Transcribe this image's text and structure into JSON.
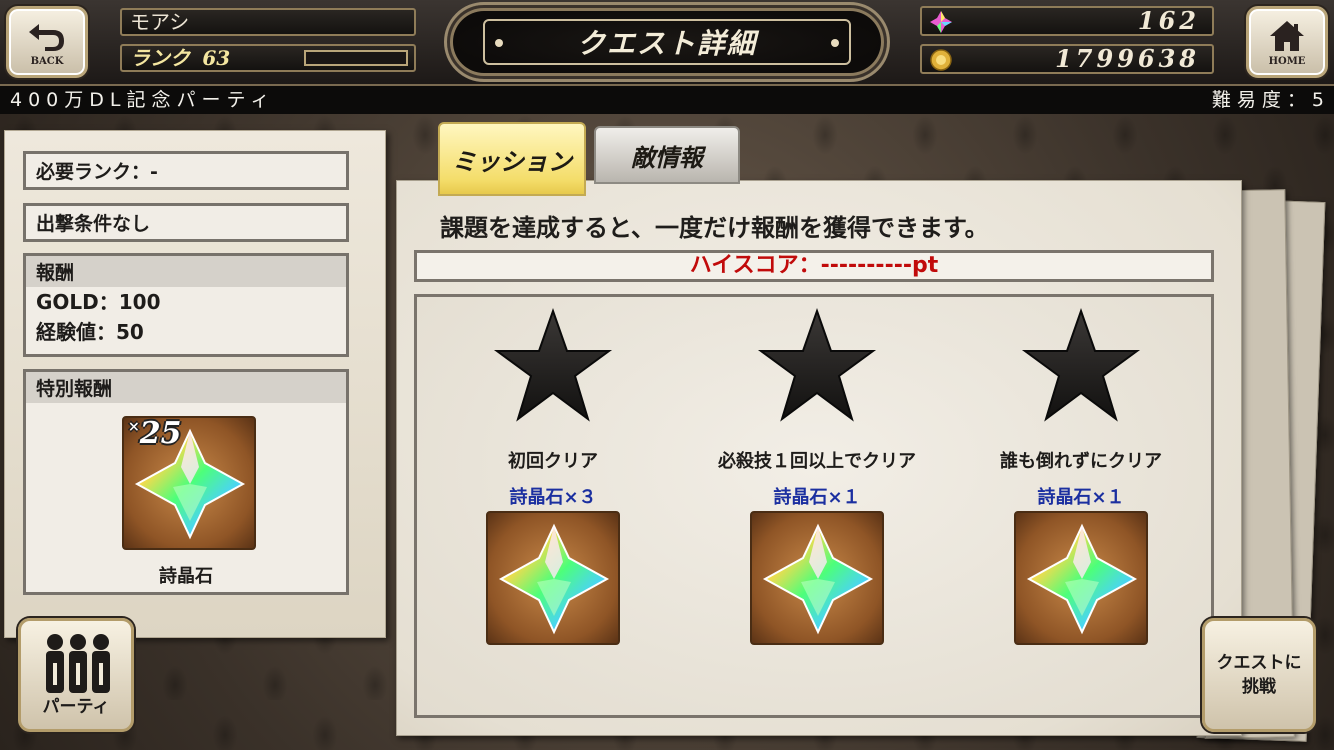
{
  "header": {
    "back_label": "BACK",
    "home_label": "HOME",
    "player_name": "モアシ",
    "rank_label": "ランク",
    "rank_value": "63",
    "rank_progress": 0.0,
    "title": "クエスト詳細",
    "gems": "162",
    "gold": "1799638"
  },
  "subbar": {
    "party_name": "400万DL記念パーティ",
    "difficulty": "難易度：5"
  },
  "left": {
    "required_rank": "必要ランク：-",
    "sortie_condition": "出撃条件なし",
    "reward_title": "報酬",
    "reward_gold": "GOLD：100",
    "reward_exp": "経験値：50",
    "special_title": "特別報酬",
    "special_qty_prefix": "×",
    "special_qty": "25",
    "special_item_name": "詩晶石",
    "party_button_label": "パーティ"
  },
  "tabs": {
    "mission": "ミッション",
    "enemy": "敵情報"
  },
  "main": {
    "description": "課題を達成すると、一度だけ報酬を獲得できます。",
    "high_score": "ハイスコア：----------pt",
    "missions": [
      {
        "label": "初回クリア",
        "reward": "詩晶石×３"
      },
      {
        "label": "必殺技１回以上でクリア",
        "reward": "詩晶石×１"
      },
      {
        "label": "誰も倒れずにクリア",
        "reward": "詩晶石×１"
      }
    ],
    "challenge_button_label": "クエストに\n挑戦"
  },
  "colors": {
    "score_red": "#c10b0b",
    "reward_blue": "#1b2fa0",
    "mission_tab_yellow": "#f4dd6a"
  },
  "icons": {
    "back": "back-arrow-icon",
    "home": "house-icon",
    "gem": "crystal-icon",
    "gold": "gold-coin-icon",
    "mission_star": "star-icon",
    "party": "party-members-icon"
  }
}
